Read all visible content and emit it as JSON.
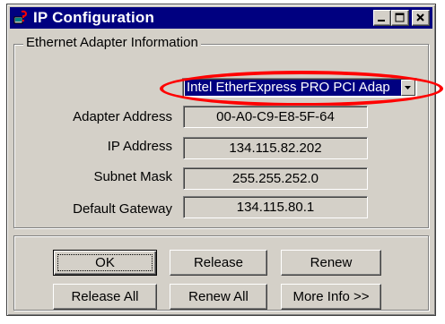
{
  "window": {
    "title": "IP Configuration",
    "colors": {
      "titlebar": "#000080",
      "face": "#d4d0c8",
      "highlight_oval": "#ff0000"
    }
  },
  "group": {
    "label": "Ethernet  Adapter Information"
  },
  "adapter": {
    "selected": "Intel EtherExpress PRO PCI Adap"
  },
  "fields": [
    {
      "label": "Adapter Address",
      "value": "00-A0-C9-E8-5F-64"
    },
    {
      "label": "IP Address",
      "value": "134.115.82.202"
    },
    {
      "label": "Subnet Mask",
      "value": "255.255.252.0"
    },
    {
      "label": "Default Gateway",
      "value": "134.115.80.1"
    }
  ],
  "buttons": {
    "ok": "OK",
    "release": "Release",
    "renew": "Renew",
    "release_all": "Release All",
    "renew_all": "Renew All",
    "more_info": "More Info >>"
  },
  "icons": {
    "app": "network-question-icon",
    "minimize": "minimize-icon",
    "maximize": "maximize-icon",
    "close": "close-icon",
    "dropdown": "chevron-down-icon"
  }
}
